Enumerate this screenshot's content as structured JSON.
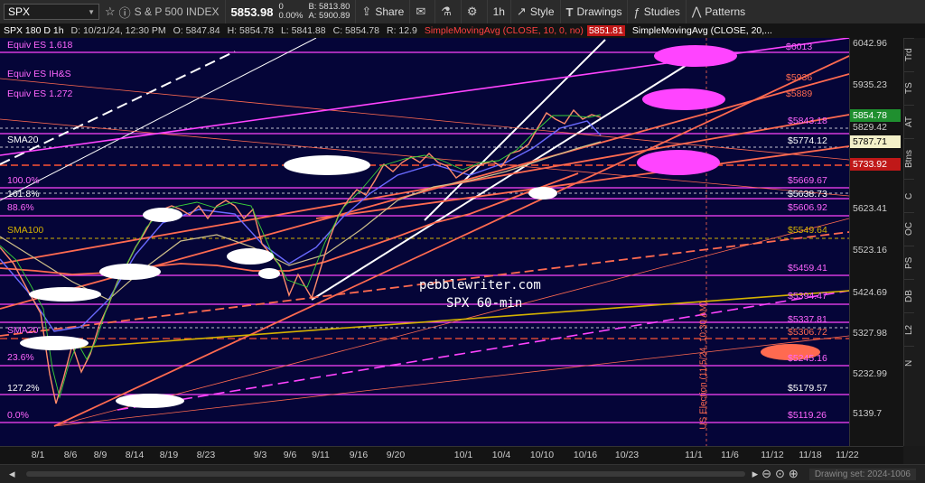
{
  "toolbar": {
    "symbol": "SPX",
    "index_name": "S & P 500 INDEX",
    "last_price": "5853.98",
    "change": "0",
    "change_pct": "0.00%",
    "bid": "B: 5813.80",
    "ask": "A: 5900.89",
    "share_label": "Share",
    "interval_label": "1h",
    "style_label": "Style",
    "drawings_label": "Drawings",
    "studies_label": "Studies",
    "patterns_label": "Patterns"
  },
  "quote_row": {
    "title": "SPX 180 D 1h",
    "date": "D: 10/21/24, 12:30 PM",
    "open": "O: 5847.84",
    "high": "H: 5854.78",
    "low": "L: 5841.88",
    "close": "C: 5854.78",
    "range": "R: 12.9",
    "sma1_label": "SimpleMovingAvg (CLOSE, 10, 0, no)",
    "sma1_value": "5851.81",
    "sma2_label": "SimpleMovingAvg (CLOSE, 20,..."
  },
  "chart_labels": {
    "equiv_1618": "Equiv ES 1.618",
    "equiv_ihs": "Equiv ES IH&S",
    "equiv_1272": "Equiv ES 1.272",
    "sma20_a": "SMA20",
    "pct_100": "100.0%",
    "pct_1618": "161.8%",
    "pct_886": "88.6%",
    "sma100": "SMA100",
    "pct_236": "23.6%",
    "pct_1272": "127.2%",
    "pct_0": "0.0%",
    "sma20_b": "SMA20",
    "watermark_1": "pebblewriter.com",
    "watermark_2": "SPX 60-min",
    "election": "US Election (11/5/24, 10:30 AM)",
    "lvl_6013": "$6013",
    "lvl_5936": "$5936",
    "lvl_5889": "$5889",
    "lvl_5843": "$5843.18",
    "lvl_5774": "$5774.12",
    "lvl_5669": "$5669.67",
    "lvl_5638": "$5638.73",
    "lvl_5606": "$5606.92",
    "lvl_5549": "$5549.64",
    "lvl_5459": "$5459.41",
    "lvl_5394": "$5394.47",
    "lvl_5337": "$5337.81",
    "lvl_5306": "$5306.72",
    "lvl_5245": "$5245.16",
    "lvl_5179": "$5179.57",
    "lvl_5119": "$5119.26"
  },
  "price_axis": {
    "ticks": [
      "6042.96",
      "5935.23",
      "5829.42",
      "5623.41",
      "5523.16",
      "5424.69",
      "5327.98",
      "5232.99",
      "5139.7"
    ],
    "tag_last": "5854.78",
    "tag_sma20": "5787.71",
    "tag_red": "5733.92"
  },
  "time_axis": {
    "ticks": [
      "8/1",
      "8/6",
      "8/9",
      "8/14",
      "8/19",
      "8/23",
      "9/3",
      "9/6",
      "9/11",
      "9/16",
      "9/20",
      "10/1",
      "10/4",
      "10/10",
      "10/16",
      "10/23",
      "11/1",
      "11/6",
      "11/12",
      "11/18",
      "11/22"
    ]
  },
  "side_tabs": [
    "Trd",
    "TS",
    "AT",
    "Btns",
    "C",
    "OC",
    "PS",
    "DB",
    "L2",
    "N"
  ],
  "bottom_bar": {
    "drawing_set": "Drawing set: 2024-1006"
  },
  "colors": {
    "chart_bg": "#050538",
    "magenta": "#ff44ff",
    "salmon": "#ff6a50",
    "white_line": "#ffffff",
    "gold": "#d4b200"
  }
}
